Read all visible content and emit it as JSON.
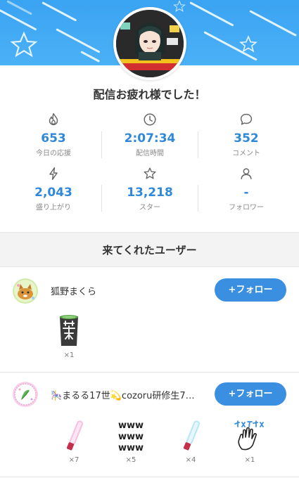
{
  "header": {
    "accent": "#3aa3f2",
    "avatar_icon": "streamer-avatar-icon"
  },
  "thanks_message": "配信お疲れ様でした！",
  "stats": [
    {
      "icon": "flame-icon",
      "value": "653",
      "label": "今日の応援"
    },
    {
      "icon": "clock-icon",
      "value": "2:07:34",
      "label": "配信時間"
    },
    {
      "icon": "comment-icon",
      "value": "352",
      "label": "コメント"
    },
    {
      "icon": "lightning-icon",
      "value": "2,043",
      "label": "盛り上がり"
    },
    {
      "icon": "star-icon",
      "value": "13,218",
      "label": "スター"
    },
    {
      "icon": "person-icon",
      "value": "-",
      "label": "フォロワー"
    }
  ],
  "visitors": {
    "title": "来てくれたユーザー",
    "follow_label": "+フォロー",
    "users": [
      {
        "name": "狐野まくら",
        "gifts": [
          {
            "icon": "tea-cup-icon",
            "count": "×1"
          }
        ]
      },
      {
        "name": "🎠まるる17世💫cozoru研修生7…",
        "gifts": [
          {
            "icon": "pink-glowstick-icon",
            "count": "×7"
          },
          {
            "icon": "www-text-icon",
            "count": "×5"
          },
          {
            "icon": "blue-glowstick-icon",
            "count": "×4"
          },
          {
            "icon": "byebye-hand-icon",
            "count": "×1"
          }
        ]
      }
    ]
  },
  "colors": {
    "value_blue": "#2f89d8",
    "button_blue": "#3b8fe0"
  }
}
